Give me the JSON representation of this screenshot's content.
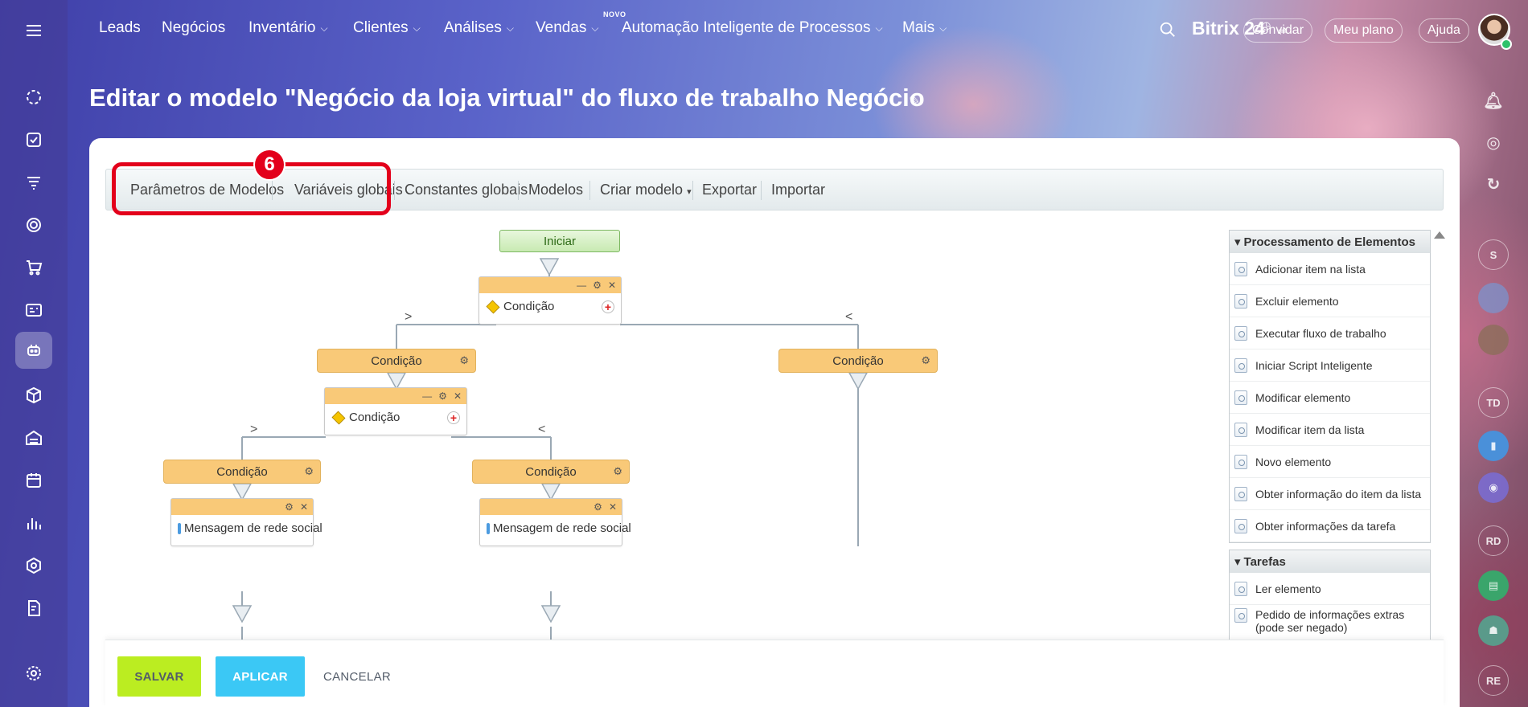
{
  "topnav": {
    "items": [
      "Leads",
      "Negócios",
      "Inventário",
      "Clientes",
      "Análises",
      "Vendas",
      "Automação Inteligente de Processos",
      "Mais"
    ],
    "new_badge": "NOVO",
    "brand": "Bitrix 24",
    "invite": "Convidar",
    "my_plan": "Meu plano",
    "help": "Ajuda"
  },
  "rail": {
    "initials": [
      "S",
      "TD",
      "RD",
      "RE"
    ]
  },
  "page": {
    "title": "Editar o modelo \"Negócio da loja virtual\" do fluxo de trabalho Negócio"
  },
  "toolbar": {
    "items": [
      "Parâmetros de Modelos",
      "Variáveis globais",
      "Constantes globais",
      "Modelos",
      "Criar modelo",
      "Exportar",
      "Importar"
    ],
    "create_chevron": "▾"
  },
  "callout": {
    "number": "6"
  },
  "workflow": {
    "start": "Iniciar",
    "condition": "Condição",
    "social_message": "Mensagem de rede social",
    "branch_yes": ">",
    "branch_no": "<"
  },
  "elements_panel": {
    "group1_title": "Processamento de Elementos",
    "group1_items": [
      "Adicionar item na lista",
      "Excluir elemento",
      "Executar fluxo de trabalho",
      "Iniciar Script Inteligente",
      "Modificar elemento",
      "Modificar item da lista",
      "Novo elemento",
      "Obter informação do item da lista",
      "Obter informações da tarefa"
    ],
    "group2_title": "Tarefas",
    "group2_items": [
      "Ler elemento",
      "Pedido de informações extras (pode ser negado)"
    ]
  },
  "footer": {
    "save": "SALVAR",
    "apply": "APLICAR",
    "cancel": "CANCELAR"
  },
  "colors": {
    "accent_red": "#e3001b",
    "save_green": "#bbed21",
    "apply_blue": "#3bc8f5",
    "block_orange": "#f9c978"
  }
}
